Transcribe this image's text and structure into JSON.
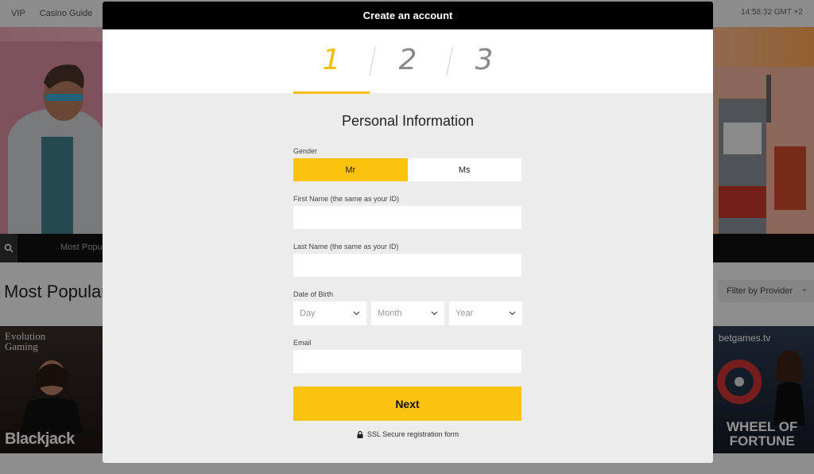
{
  "site": {
    "nav": [
      "VIP",
      "Casino Guide"
    ],
    "clock": "14:58:32  GMT +2",
    "category_label": "Most Popular",
    "section_title": "Most Popular",
    "filter_label": "Filter by Provider",
    "tile_left": {
      "brand_line1": "Evolution",
      "brand_line2": "Gaming",
      "title": "Blackjack"
    },
    "tile_right": {
      "brand": "betgames.tv",
      "title_line1": "WHEEL OF",
      "title_line2": "FORTUNE"
    }
  },
  "modal": {
    "title": "Create an account",
    "steps": [
      "1",
      "2",
      "3"
    ],
    "active_step": 1,
    "section_title": "Personal Information",
    "gender": {
      "label": "Gender",
      "options": [
        "Mr",
        "Ms"
      ],
      "selected": "Mr"
    },
    "first_name": {
      "label": "First Name (the same as your ID)",
      "value": ""
    },
    "last_name": {
      "label": "Last Name (the same as your ID)",
      "value": ""
    },
    "dob": {
      "label": "Date of Birth",
      "day": "Day",
      "month": "Month",
      "year": "Year"
    },
    "email": {
      "label": "Email",
      "value": ""
    },
    "next_label": "Next",
    "ssl_text": "SSL Secure registration form"
  },
  "colors": {
    "accent": "#fcc30e",
    "header": "#000000",
    "modal_bg": "#ececec"
  }
}
